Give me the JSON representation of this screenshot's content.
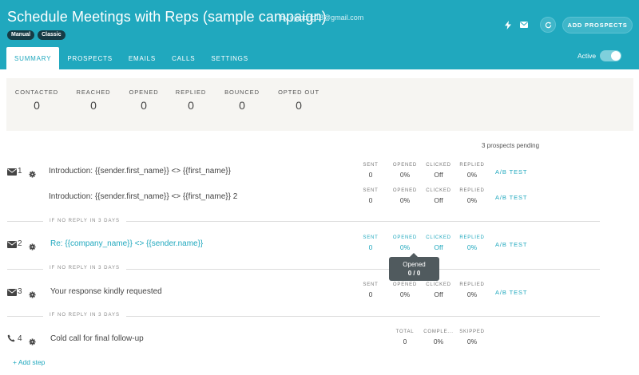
{
  "header": {
    "title": "Schedule Meetings with Reps (sample campaign)",
    "byline": "by ejabong18@gmail.com",
    "badges": [
      "Manual",
      "Classic"
    ],
    "add_prospects_label": "ADD PROSPECTS",
    "icons": [
      "bolt-icon",
      "envelope-icon",
      "refresh-icon"
    ]
  },
  "tabs": [
    "SUMMARY",
    "PROSPECTS",
    "EMAILS",
    "CALLS",
    "SETTINGS"
  ],
  "active_toggle": {
    "label": "Active",
    "on": true
  },
  "stats": [
    {
      "label": "CONTACTED",
      "value": "0"
    },
    {
      "label": "REACHED",
      "value": "0"
    },
    {
      "label": "OPENED",
      "value": "0"
    },
    {
      "label": "REPLIED",
      "value": "0"
    },
    {
      "label": "BOUNCED",
      "value": "0"
    },
    {
      "label": "OPTED OUT",
      "value": "0"
    }
  ],
  "pending": "3 prospects pending",
  "metric_labels": {
    "sent": "SENT",
    "opened": "OPENED",
    "clicked": "CLICKED",
    "replied": "REPLIED",
    "total": "TOTAL",
    "completed": "COMPLE...",
    "skipped": "SKIPPED"
  },
  "ab_test": "A/B TEST",
  "steps": [
    {
      "number": "1",
      "variants": [
        {
          "name": "Introduction: {{sender.first_name}} <> {{first_name}}",
          "sent": "0",
          "opened": "0%",
          "clicked": "Off",
          "replied": "0%"
        },
        {
          "name": "Introduction: {{sender.first_name}} <> {{first_name}} 2",
          "sent": "0",
          "opened": "0%",
          "clicked": "Off",
          "replied": "0%"
        }
      ]
    },
    {
      "number": "2",
      "delay": "IF NO REPLY IN 3 DAYS",
      "name": "Re: {{company_name}} <> {{sender.name}}",
      "sent": "0",
      "opened": "0%",
      "clicked": "Off",
      "replied": "0%"
    },
    {
      "number": "3",
      "delay": "IF NO REPLY IN 3 DAYS",
      "name": "Your response kindly requested",
      "sent": "0",
      "opened": "0%",
      "clicked": "Off",
      "replied": "0%"
    },
    {
      "number": "4",
      "delay": "IF NO REPLY IN 3 DAYS",
      "name": "Cold call for final follow-up",
      "total": "0",
      "completed": "0%",
      "skipped": "0%"
    }
  ],
  "tooltip": {
    "label": "Opened",
    "value": "0 / 0"
  },
  "add_step": "+ Add step",
  "colors": {
    "header": "#20a8be",
    "badge": "#163b45",
    "panel": "#f6f5f2",
    "link": "#20a8be"
  }
}
